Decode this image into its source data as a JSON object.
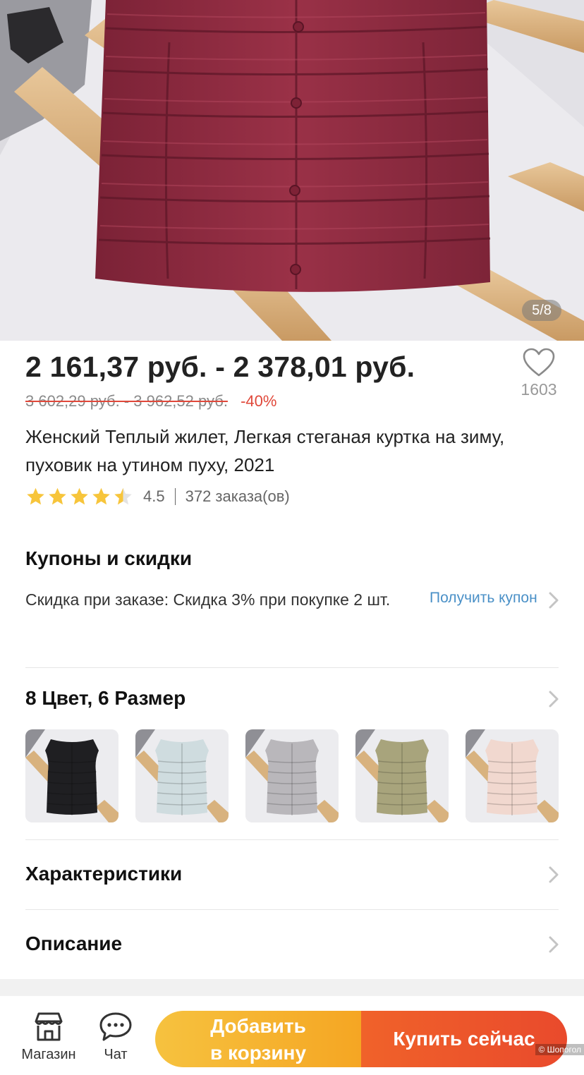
{
  "gallery": {
    "counter": "5/8"
  },
  "price": {
    "range": "2 161,37 руб. - 2 378,01 руб.",
    "old_range": "3 602,29 руб. - 3 962,52 руб.",
    "discount": "-40%"
  },
  "wishlist": {
    "icon": "heart-icon",
    "count": "1603"
  },
  "product": {
    "title": "Женский Теплый жилет, Легкая стеганая куртка на зиму, пуховик на утином пуху, 2021"
  },
  "rating": {
    "value": "4.5",
    "stars_filled": 4.5,
    "stars_total": 5,
    "orders": "372 заказа(ов)"
  },
  "coupons": {
    "title": "Купоны и скидки",
    "text": "Скидка при заказе: Скидка 3% при покупке 2 шт.",
    "link": "Получить купон"
  },
  "variants": {
    "title": "8 Цвет, 6 Размер",
    "swatches": [
      {
        "name": "black",
        "color": "#1f1f22"
      },
      {
        "name": "light-blue",
        "color": "#cfdcdf"
      },
      {
        "name": "gray",
        "color": "#b9b7bb"
      },
      {
        "name": "olive",
        "color": "#a8a47c"
      },
      {
        "name": "pink",
        "color": "#f1d8cf"
      }
    ]
  },
  "specs": {
    "title": "Характеристики"
  },
  "description": {
    "title": "Описание"
  },
  "bottom_bar": {
    "store": "Магазин",
    "chat": "Чат",
    "add_to_cart_line1": "Добавить",
    "add_to_cart_line2": "в корзину",
    "buy_now": "Купить сейчас"
  },
  "watermark": "© Шопогол",
  "colors": {
    "accent_red": "#e0483a",
    "link_blue": "#4a90c7",
    "vest_burgundy": "#8e2a3f"
  }
}
